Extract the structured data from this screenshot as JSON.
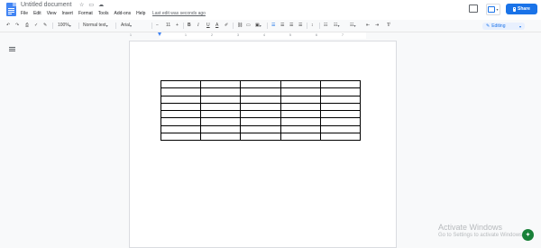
{
  "app": {
    "doc_title": "Untitled document",
    "last_edit": "Last edit was seconds ago"
  },
  "menu": [
    "File",
    "Edit",
    "View",
    "Insert",
    "Format",
    "Tools",
    "Add-ons",
    "Help"
  ],
  "header_buttons": {
    "share": "Share"
  },
  "toolbar": {
    "zoom": "100%",
    "style": "Normal text",
    "font": "Arial",
    "font_size": "11",
    "minus": "−",
    "plus": "+",
    "bold": "B",
    "italic": "I",
    "underline": "U",
    "text_color": "A",
    "editing_mode": "Editing",
    "accent_color": "#1a73e8"
  },
  "ruler": {
    "labels": [
      "1",
      "1",
      "2",
      "3",
      "4",
      "5",
      "6",
      "7"
    ]
  },
  "document": {
    "table": {
      "rows": 8,
      "columns": 5
    }
  },
  "watermark": {
    "line1": "Activate Windows",
    "line2": "Go to Settings to activate Windows."
  }
}
